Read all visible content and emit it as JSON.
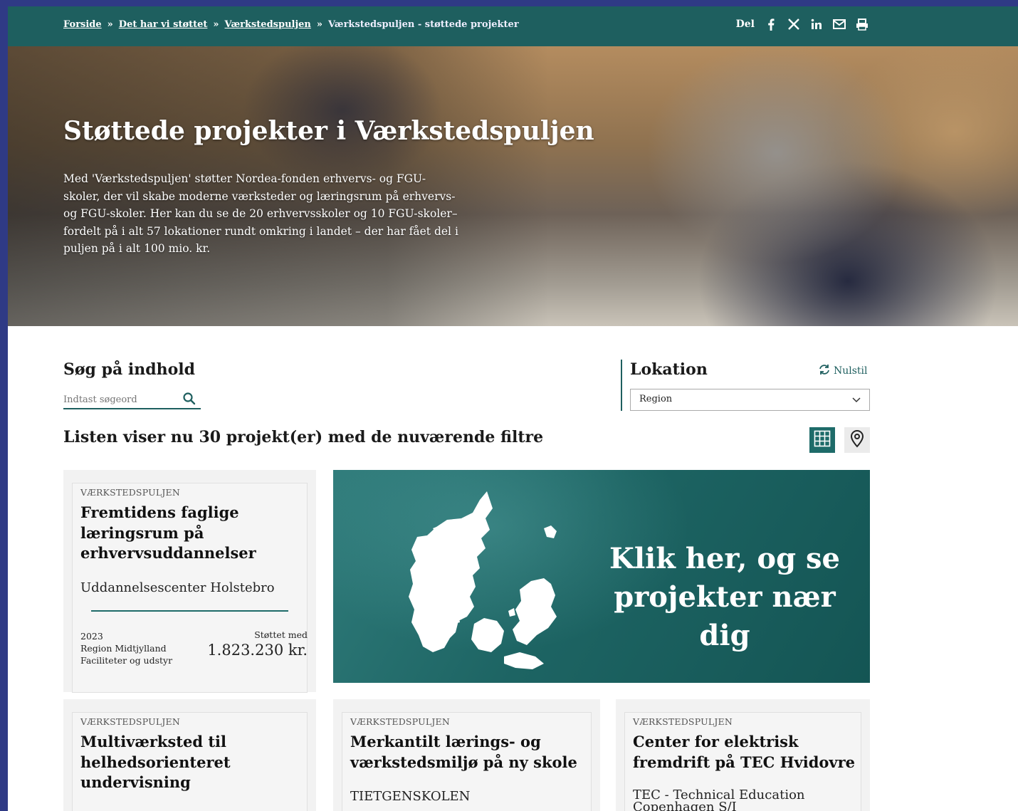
{
  "breadcrumb": {
    "items": [
      "Forside",
      "Det har vi støttet",
      "Værkstedspuljen"
    ],
    "separator": "»",
    "current": "Værkstedspuljen - støttede projekter"
  },
  "share": {
    "label": "Del",
    "icons": [
      "facebook-icon",
      "x-icon",
      "linkedin-icon",
      "mail-icon",
      "print-icon"
    ]
  },
  "hero": {
    "title": "Støttede projekter i Værkstedspuljen",
    "text": "Med 'Værkstedspuljen' støtter Nordea-fonden erhvervs- og FGU-skoler, der vil skabe moderne værksteder og læringsrum på erhvervs- og FGU-skoler. Her kan du se de 20 erhvervsskoler og 10 FGU-skoler– fordelt på i alt 57 lokationer rundt omkring i landet – der har fået del i puljen på i alt 100 mio. kr."
  },
  "search": {
    "heading": "Søg på indhold",
    "placeholder": "Indtast søgeord"
  },
  "location": {
    "heading": "Lokation",
    "reset_label": "Nulstil",
    "select_value": "Region"
  },
  "results": {
    "heading": "Listen viser nu 30 projekt(er) med de nuværende filtre"
  },
  "map_banner": {
    "text": "Klik her, og se projekter nær dig"
  },
  "cards": [
    {
      "tag": "VÆRKSTEDSPULJEN",
      "title": "Fremtidens faglige læringsrum på erhvervsuddannelser",
      "org": "Uddannelsescenter Holstebro",
      "year": "2023",
      "region": "Region Midtjylland",
      "category": "Faciliteter og udstyr",
      "supported_label": "Støttet med",
      "amount": "1.823.230 kr."
    },
    {
      "tag": "VÆRKSTEDSPULJEN",
      "title": "Multiværksted til helhedsorienteret undervisning",
      "org": ""
    },
    {
      "tag": "VÆRKSTEDSPULJEN",
      "title": "Merkantilt lærings- og værkstedsmiljø på ny skole",
      "org": "TIETGENSKOLEN"
    },
    {
      "tag": "VÆRKSTEDSPULJEN",
      "title": "Center for elektrisk fremdrift på TEC Hvidovre",
      "org": "TEC - Technical Education Copenhagen S/I"
    }
  ],
  "colors": {
    "brand_teal": "#1e5f5f",
    "outer_border": "#2f3a85"
  }
}
